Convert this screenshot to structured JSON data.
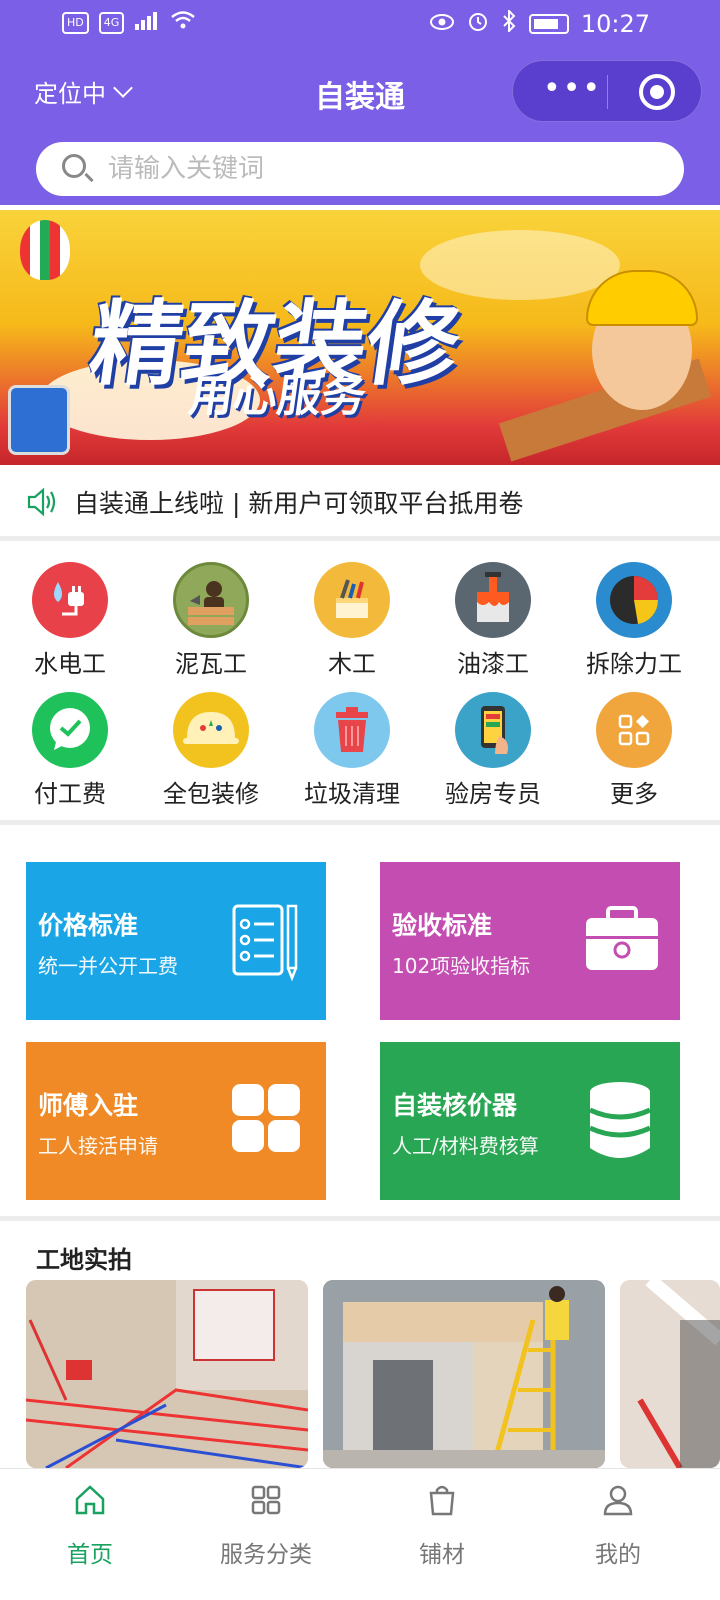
{
  "status_bar": {
    "left_badges": [
      "HD",
      "4G"
    ],
    "time": "10:27"
  },
  "nav": {
    "location_label": "定位中",
    "title": "自装通",
    "more_icon": "more-dots-icon",
    "close_icon": "target-icon"
  },
  "search": {
    "placeholder": "请输入关键词"
  },
  "banner": {
    "headline": "精致装修",
    "subline": "用心服务"
  },
  "notice": {
    "text": "自装通上线啦 | 新用户可领取平台抵用卷"
  },
  "service_grid": [
    {
      "label": "水电工",
      "icon": "plug-icon",
      "color": "#e8414a"
    },
    {
      "label": "泥瓦工",
      "icon": "bricklayer-icon",
      "color": "#8fa85a"
    },
    {
      "label": "木工",
      "icon": "toolbox-icon",
      "color": "#f3b93a"
    },
    {
      "label": "油漆工",
      "icon": "paint-icon",
      "color": "#5a6670"
    },
    {
      "label": "拆除力工",
      "icon": "pie-chart-icon",
      "color": "#2a8ccf"
    },
    {
      "label": "付工费",
      "icon": "pay-icon",
      "color": "#1ec15a"
    },
    {
      "label": "全包装修",
      "icon": "helmet-icon",
      "color": "#f2c21f"
    },
    {
      "label": "垃圾清理",
      "icon": "trash-icon",
      "color": "#7ec8ee"
    },
    {
      "label": "验房专员",
      "icon": "phone-inspect-icon",
      "color": "#3ba2c8"
    },
    {
      "label": "更多",
      "icon": "more-grid-icon",
      "color": "#f0a63d"
    }
  ],
  "cards": [
    {
      "title": "价格标准",
      "subtitle": "统一并公开工费",
      "color": "#1aa6e6",
      "icon": "checklist-icon"
    },
    {
      "title": "验收标准",
      "subtitle": "102项验收指标",
      "color": "#c34db0",
      "icon": "toolbox-case-icon"
    },
    {
      "title": "师傅入驻",
      "subtitle": "工人接活申请",
      "color": "#ef8a26",
      "icon": "apps-grid-icon"
    },
    {
      "title": "自装核价器",
      "subtitle": "人工/材料费核算",
      "color": "#28a653",
      "icon": "database-icon"
    }
  ],
  "section": {
    "title": "工地实拍"
  },
  "tabbar": [
    {
      "label": "首页",
      "icon": "home-icon",
      "active": true
    },
    {
      "label": "服务分类",
      "icon": "category-grid-icon",
      "active": false
    },
    {
      "label": "铺材",
      "icon": "shopping-bag-icon",
      "active": false
    },
    {
      "label": "我的",
      "icon": "user-icon",
      "active": false
    }
  ],
  "colors": {
    "header": "#7b5fe6",
    "active_tab": "#19a15f"
  }
}
